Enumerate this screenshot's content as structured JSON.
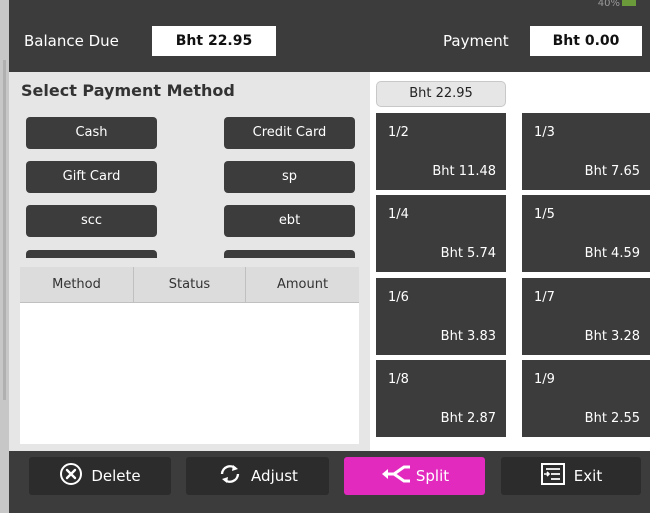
{
  "status": {
    "battery_text": "40%"
  },
  "header": {
    "balance_label": "Balance Due",
    "balance_value": "Bht 22.95",
    "payment_label": "Payment",
    "payment_value": "Bht 0.00"
  },
  "methods": {
    "title": "Select Payment Method",
    "buttons": [
      "Cash",
      "Credit Card",
      "Gift Card",
      "sp",
      "scc",
      "ebt"
    ]
  },
  "table": {
    "headers": [
      "Method",
      "Status",
      "Amount"
    ],
    "rows": []
  },
  "split": {
    "total": "Bht 22.95",
    "tiles": [
      {
        "fraction": "1/2",
        "amount": "Bht 11.48"
      },
      {
        "fraction": "1/3",
        "amount": "Bht 7.65"
      },
      {
        "fraction": "1/4",
        "amount": "Bht 5.74"
      },
      {
        "fraction": "1/5",
        "amount": "Bht 4.59"
      },
      {
        "fraction": "1/6",
        "amount": "Bht 3.83"
      },
      {
        "fraction": "1/7",
        "amount": "Bht 3.28"
      },
      {
        "fraction": "1/8",
        "amount": "Bht 2.87"
      },
      {
        "fraction": "1/9",
        "amount": "Bht 2.55"
      }
    ]
  },
  "actions": {
    "delete": "Delete",
    "adjust": "Adjust",
    "split": "Split",
    "exit": "Exit"
  },
  "colors": {
    "dark": "#3c3c3c",
    "split_accent": "#e22abf",
    "panel": "#e6e6e6"
  },
  "icons": {
    "delete": "x-circle-icon",
    "adjust": "refresh-icon",
    "split": "split-arrow-icon",
    "exit": "exit-register-icon"
  }
}
